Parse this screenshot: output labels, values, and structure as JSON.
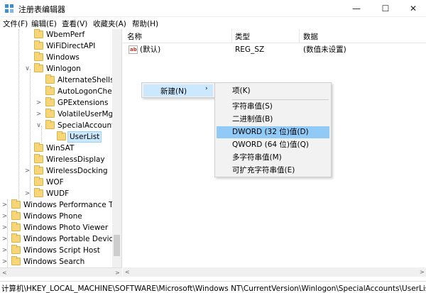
{
  "window": {
    "title": "注册表编辑器",
    "minimize": "—",
    "maximize": "☐",
    "close": "✕"
  },
  "menubar": {
    "items": [
      "文件(F)",
      "编辑(E)",
      "查看(V)",
      "收藏夹(A)",
      "帮助(H)"
    ]
  },
  "tree": {
    "items": [
      {
        "label": "WbemPerf",
        "expander": ""
      },
      {
        "label": "WiFiDirectAPI",
        "expander": ""
      },
      {
        "label": "Windows",
        "expander": ""
      },
      {
        "label": "Winlogon",
        "expander": "∨"
      },
      {
        "label": "AlternateShells",
        "expander": ""
      },
      {
        "label": "AutoLogonCheck",
        "expander": ""
      },
      {
        "label": "GPExtensions",
        "expander": ">"
      },
      {
        "label": "VolatileUserMgr",
        "expander": ">"
      },
      {
        "label": "SpecialAccounts",
        "expander": "∨"
      },
      {
        "label": "UserList",
        "expander": ""
      },
      {
        "label": "WinSAT",
        "expander": ""
      },
      {
        "label": "WirelessDisplay",
        "expander": ""
      },
      {
        "label": "WirelessDocking",
        "expander": ">"
      },
      {
        "label": "WOF",
        "expander": ""
      },
      {
        "label": "WUDF",
        "expander": ">"
      },
      {
        "label": "Windows Performance Too",
        "expander": ">"
      },
      {
        "label": "Windows Phone",
        "expander": ">"
      },
      {
        "label": "Windows Photo Viewer",
        "expander": ">"
      },
      {
        "label": "Windows Portable Devices",
        "expander": ">"
      },
      {
        "label": "Windows Script Host",
        "expander": ">"
      },
      {
        "label": "Windows Search",
        "expander": ">"
      }
    ],
    "selected": "UserList"
  },
  "list": {
    "columns": [
      "名称",
      "类型",
      "数据"
    ],
    "rows": [
      {
        "name": "(默认)",
        "type": "REG_SZ",
        "data": "(数值未设置)"
      }
    ],
    "icon_text": "ab"
  },
  "context_menu": {
    "new_label": "新建(N)",
    "arrow": "›",
    "submenu": [
      "项(K)",
      "字符串值(S)",
      "二进制值(B)",
      "DWORD (32 位)值(D)",
      "QWORD (64 位)值(Q)",
      "多字符串值(M)",
      "可扩充字符串值(E)"
    ],
    "highlighted": "DWORD (32 位)值(D)"
  },
  "statusbar": {
    "path": "计算机\\HKEY_LOCAL_MACHINE\\SOFTWARE\\Microsoft\\Windows NT\\CurrentVersion\\Winlogon\\SpecialAccounts\\UserList"
  },
  "scroll": {
    "left_arrow": "<",
    "right_arrow": ">"
  },
  "colors": {
    "selection": "#cce8ff",
    "menu_highlight": "#91c9f7",
    "folder": "#f6d676"
  }
}
